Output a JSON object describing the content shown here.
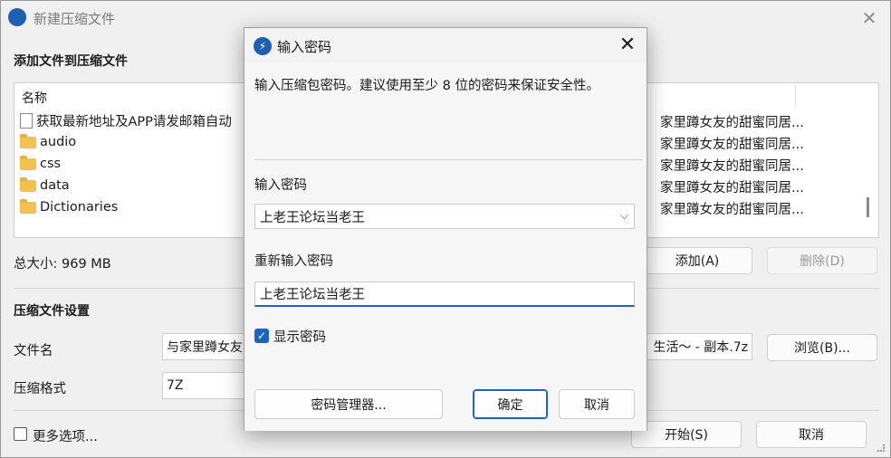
{
  "main_window": {
    "title": "新建压缩文件",
    "add_section_title": "添加文件到压缩文件",
    "file_list": {
      "column_name": "名称",
      "items": [
        {
          "name": "获取最新地址及APP请发邮箱自动",
          "icon": "document-icon",
          "extra": "家里蹲女友的甜蜜同居..."
        },
        {
          "name": "audio",
          "icon": "folder-icon",
          "extra": "家里蹲女友的甜蜜同居..."
        },
        {
          "name": "css",
          "icon": "folder-icon",
          "extra": "家里蹲女友的甜蜜同居..."
        },
        {
          "name": "data",
          "icon": "folder-icon",
          "extra": "家里蹲女友的甜蜜同居..."
        },
        {
          "name": "Dictionaries",
          "icon": "folder-icon",
          "extra": "家里蹲女友的甜蜜同居..."
        }
      ]
    },
    "total_size": "总大小: 969 MB",
    "add_button": "添加(A)",
    "delete_button": "删除(D)",
    "settings_title": "压缩文件设置",
    "filename_label": "文件名",
    "filename_value": "与家里蹲女友",
    "filename_tail": "生活～ - 副本.7z",
    "browse_button": "浏览(B)...",
    "format_label": "压缩格式",
    "format_value": "7Z",
    "more_options": "更多选项...",
    "start_button": "开始(S)",
    "cancel_button": "取消"
  },
  "dialog": {
    "title": "输入密码",
    "description": "输入压缩包密码。建议使用至少 8 位的密码来保证安全性。",
    "password_label": "输入密码",
    "password_value": "上老王论坛当老王",
    "reenter_label": "重新输入密码",
    "reenter_value": "上老王论坛当老王",
    "show_password": "显示密码",
    "show_password_checked": true,
    "manager_button": "密码管理器...",
    "ok_button": "确定",
    "cancel_button": "取消"
  },
  "colors": {
    "accent": "#1a64c6",
    "window_bg": "#f0f0f0",
    "dialog_bg": "#f3f3f3"
  }
}
